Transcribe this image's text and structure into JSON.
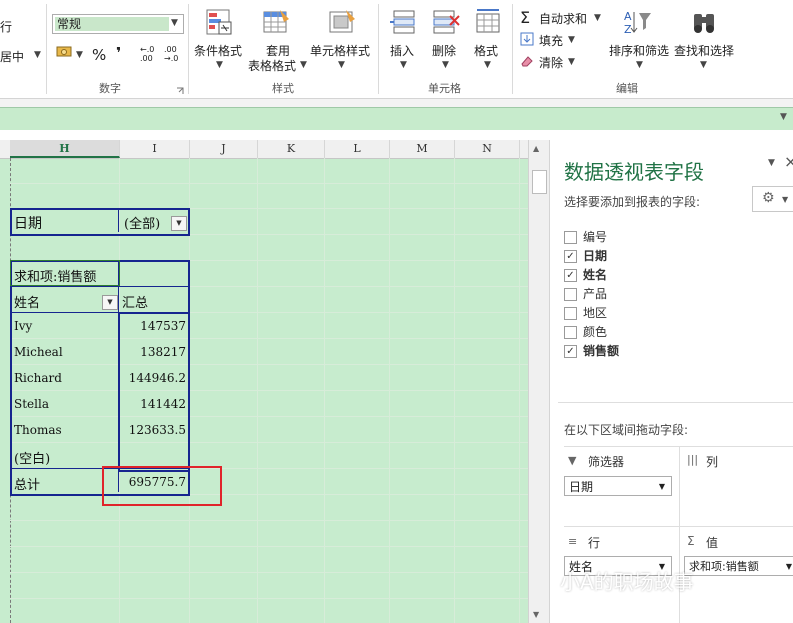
{
  "ribbon": {
    "align_wrap": "行",
    "align_merge": "居中",
    "number_format": "常规",
    "percent": "%",
    "comma": "❜",
    "dec_inc": "←.0 .00",
    "dec_dec": ".00 →.0",
    "group_number": "数字",
    "cond_format": "条件格式",
    "table_format_1": "套用",
    "table_format_2": "表格格式",
    "cell_style": "单元格样式",
    "group_styles": "样式",
    "insert": "插入",
    "delete": "删除",
    "format": "格式",
    "group_cells": "单元格",
    "autosum": "自动求和",
    "fill": "填充",
    "clear": "清除",
    "sort_filter": "排序和筛选",
    "find_select": "查找和选择",
    "group_edit": "编辑"
  },
  "columns": [
    "H",
    "I",
    "J",
    "K",
    "L",
    "M",
    "N"
  ],
  "pivot": {
    "filter_label": "日期",
    "filter_value": "(全部)",
    "values_header": "求和项:销售额",
    "row_header": "姓名",
    "col_header": "汇总",
    "rows": [
      {
        "name": "Ivy",
        "value": "147537"
      },
      {
        "name": "Micheal",
        "value": "138217"
      },
      {
        "name": "Richard",
        "value": "144946.2"
      },
      {
        "name": "Stella",
        "value": "141442"
      },
      {
        "name": "Thomas",
        "value": "123633.5"
      },
      {
        "name": "(空白)",
        "value": ""
      }
    ],
    "total_label": "总计",
    "total_value": "695775.7"
  },
  "pane": {
    "title": "数据透视表字段",
    "subtitle": "选择要添加到报表的字段:",
    "fields": [
      {
        "label": "编号",
        "checked": false,
        "bold": false
      },
      {
        "label": "日期",
        "checked": true,
        "bold": true
      },
      {
        "label": "姓名",
        "checked": true,
        "bold": true
      },
      {
        "label": "产品",
        "checked": false,
        "bold": false
      },
      {
        "label": "地区",
        "checked": false,
        "bold": false
      },
      {
        "label": "颜色",
        "checked": false,
        "bold": false
      },
      {
        "label": "销售额",
        "checked": true,
        "bold": true
      }
    ],
    "drag_hint": "在以下区域间拖动字段:",
    "filters_label": "筛选器",
    "columns_label": "列",
    "rows_label": "行",
    "values_label": "值",
    "filter_item": "日期",
    "row_item": "姓名",
    "value_item": "求和项:销售额"
  },
  "watermark": "小A的职场故事",
  "colors": {
    "sheet_bg": "#c7ecce",
    "pivot_border": "#16258f",
    "highlight": "#e0242a",
    "accent": "#217346"
  }
}
